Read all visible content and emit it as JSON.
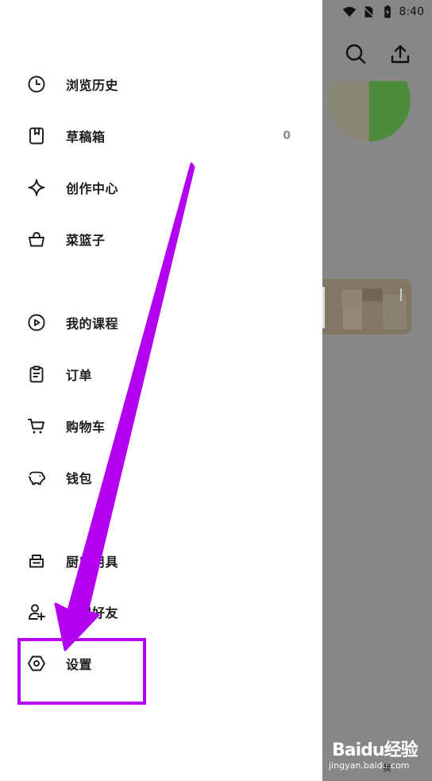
{
  "status_bar": {
    "time": "8:40"
  },
  "drawer": {
    "groups": [
      [
        {
          "label": "浏览历史",
          "icon": "clock-icon"
        },
        {
          "label": "草稿箱",
          "icon": "draft-box-icon",
          "count": "0"
        },
        {
          "label": "创作中心",
          "icon": "sparkle-icon"
        },
        {
          "label": "菜篮子",
          "icon": "basket-icon"
        }
      ],
      [
        {
          "label": "我的课程",
          "icon": "play-circle-icon"
        },
        {
          "label": "订单",
          "icon": "clipboard-icon"
        },
        {
          "label": "购物车",
          "icon": "cart-icon"
        },
        {
          "label": "钱包",
          "icon": "piggy-bank-icon"
        }
      ],
      [
        {
          "label": "厨房用具",
          "icon": "pot-icon"
        },
        {
          "label": "发现好友",
          "icon": "add-friend-icon"
        },
        {
          "label": "设置",
          "icon": "settings-hexagon-icon"
        }
      ]
    ]
  },
  "annotation": {
    "color": "#b400f0",
    "target": "设置"
  },
  "watermark": {
    "main": "Baidu经验",
    "sub": "jingyan.baidu.com",
    "tab_label": "我"
  },
  "colors": {
    "backdrop": "#878787",
    "accent_green": "#4e8b3a"
  }
}
